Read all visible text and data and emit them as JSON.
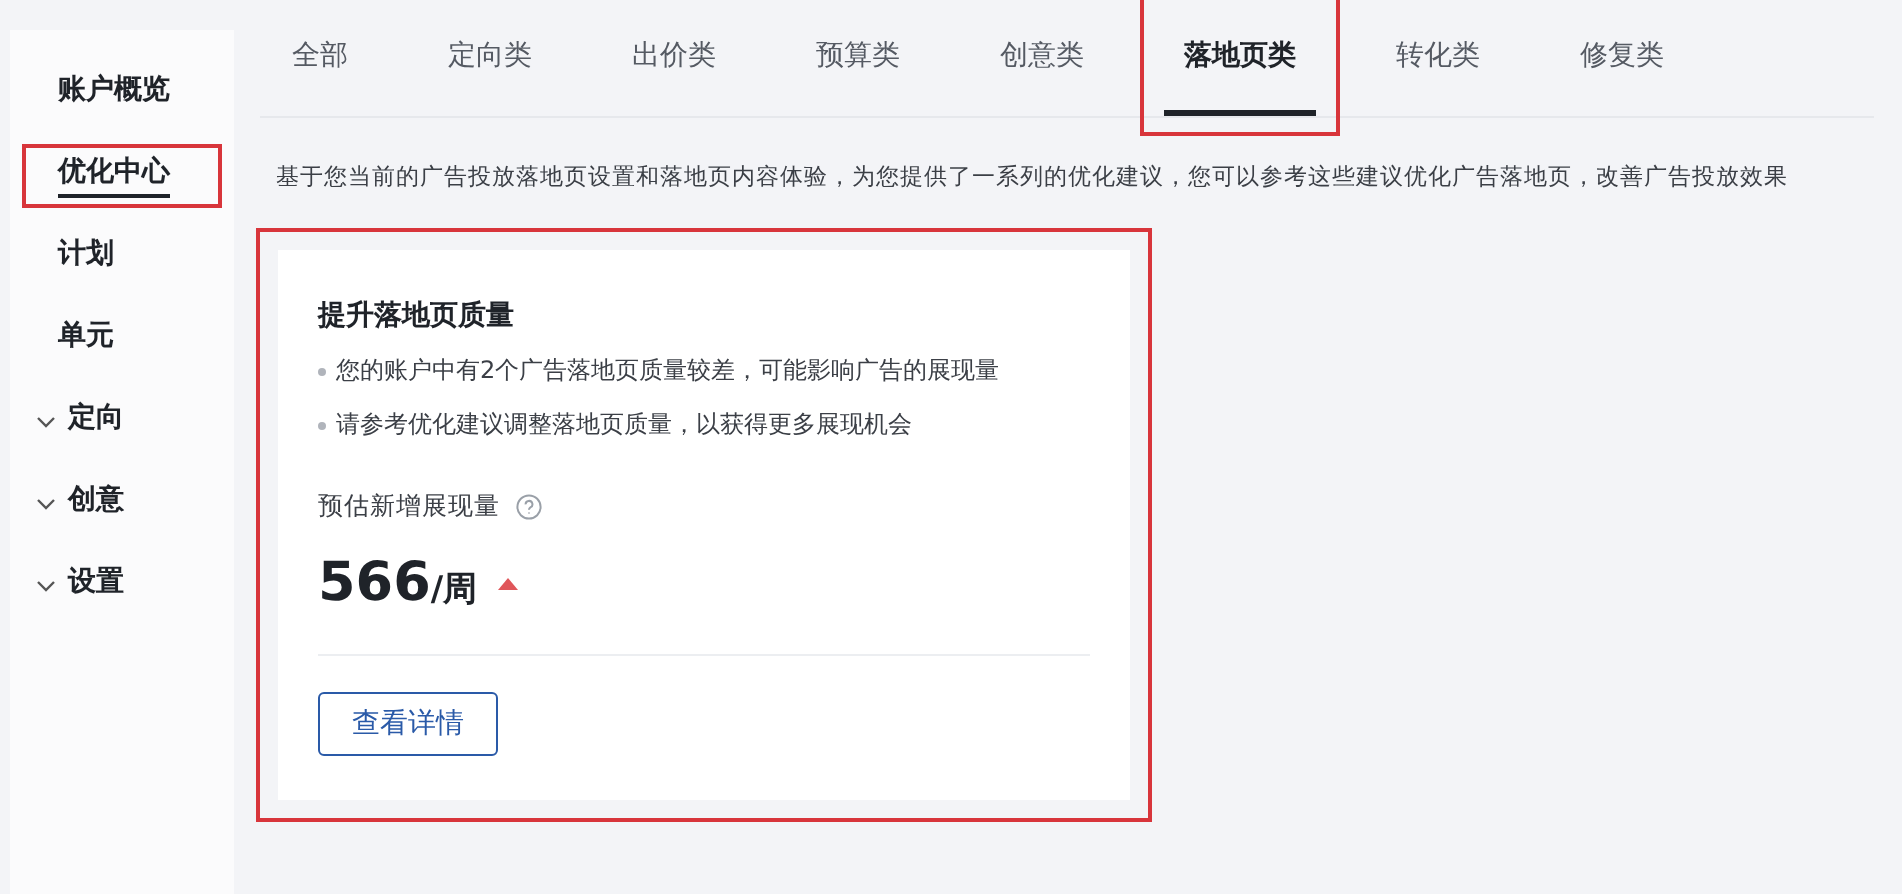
{
  "sidebar": {
    "items": [
      {
        "label": "账户概览",
        "kind": "link",
        "selected": false,
        "highlighted": false
      },
      {
        "label": "优化中心",
        "kind": "link",
        "selected": true,
        "highlighted": true
      },
      {
        "label": "计划",
        "kind": "link",
        "selected": false,
        "highlighted": false
      },
      {
        "label": "单元",
        "kind": "link",
        "selected": false,
        "highlighted": false
      },
      {
        "label": "定向",
        "kind": "group",
        "selected": false,
        "highlighted": false
      },
      {
        "label": "创意",
        "kind": "group",
        "selected": false,
        "highlighted": false
      },
      {
        "label": "设置",
        "kind": "group",
        "selected": false,
        "highlighted": false
      }
    ]
  },
  "tabs": [
    {
      "label": "全部",
      "selected": false,
      "highlighted": false
    },
    {
      "label": "定向类",
      "selected": false,
      "highlighted": false
    },
    {
      "label": "出价类",
      "selected": false,
      "highlighted": false
    },
    {
      "label": "预算类",
      "selected": false,
      "highlighted": false
    },
    {
      "label": "创意类",
      "selected": false,
      "highlighted": false
    },
    {
      "label": "落地页类",
      "selected": true,
      "highlighted": true
    },
    {
      "label": "转化类",
      "selected": false,
      "highlighted": false
    },
    {
      "label": "修复类",
      "selected": false,
      "highlighted": false
    }
  ],
  "description": "基于您当前的广告投放落地页设置和落地页内容体验，为您提供了一系列的优化建议，您可以参考这些建议优化广告落地页，改善广告投放效果",
  "card": {
    "highlighted": true,
    "title": "提升落地页质量",
    "bullets": [
      "您的账户中有2个广告落地页质量较差，可能影响广告的展现量",
      "请参考优化建议调整落地页质量，以获得更多展现机会"
    ],
    "metric_label": "预估新增展现量",
    "metric_value": "566",
    "metric_unit": "/周",
    "trend_up": true,
    "button": "查看详情"
  }
}
